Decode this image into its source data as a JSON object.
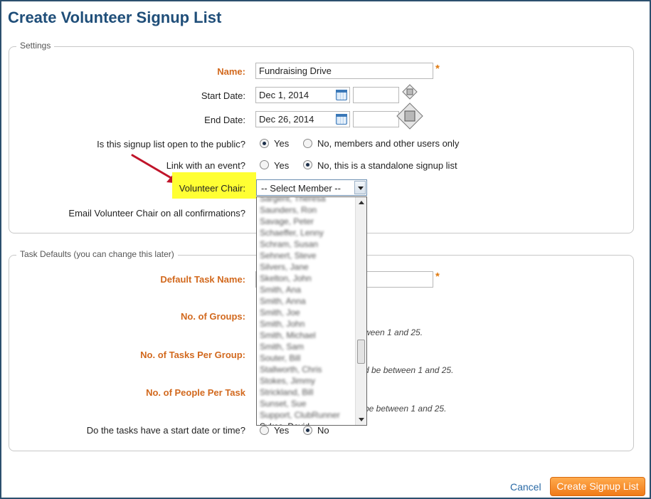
{
  "page": {
    "title": "Create Volunteer Signup List"
  },
  "settings": {
    "legend": "Settings",
    "name_label": "Name:",
    "name_value": "Fundraising Drive",
    "required_mark": "*",
    "start_label": "Start Date:",
    "start_value": "Dec 1, 2014",
    "end_label": "End Date:",
    "end_value": "Dec 26, 2014",
    "public_question": "Is this signup list open to the public?",
    "public_yes": "Yes",
    "public_no": "No, members and other users only",
    "public_selected": "Yes",
    "event_question": "Link with an event?",
    "event_yes": "Yes",
    "event_no": "No, this is a standalone signup list",
    "event_selected": "No",
    "chair_label": "Volunteer Chair:",
    "chair_selected": "-- Select Member --",
    "email_chair_label": "Email Volunteer Chair on all confirmations?"
  },
  "dropdown": {
    "options": [
      "Sargent, Theresa",
      "Saunders, Ron",
      "Savage, Peter",
      "Schaeffer, Lenny",
      "Schram, Susan",
      "Sehnert, Steve",
      "Silvers, Jane",
      "Skelton, John",
      "Smith, Ana",
      "Smith, Anna",
      "Smith, Joe",
      "Smith, John",
      "Smith, Michael",
      "Smith, Sam",
      "Souter, Bill",
      "Stallworth, Chris",
      "Stokes, Jimmy",
      "Strickland, Bill",
      "Sunset, Sue",
      "Support, ClubRunner",
      "Sykes, David"
    ]
  },
  "task_defaults": {
    "legend": "Task Defaults (you can change this later)",
    "task_name_label": "Default Task Name:",
    "groups_label": "No. of Groups:",
    "groups_hint": "ween 1 and 25.",
    "tasks_label": "No. of Tasks Per Group:",
    "tasks_hint": "d be between 1 and 25.",
    "people_label": "No. of People Per Task",
    "people_hint": "be between 1 and 25.",
    "start_question": "Do the tasks have a start date or time?",
    "start_yes": "Yes",
    "start_no": "No",
    "start_selected": "No"
  },
  "footer": {
    "cancel_label": "Cancel",
    "create_label": "Create Signup List"
  },
  "colors": {
    "title": "#1f4e79",
    "accent_orange": "#d2691e",
    "highlight": "#ffff33",
    "arrow": "#c0142a",
    "button": "#f07a18"
  }
}
